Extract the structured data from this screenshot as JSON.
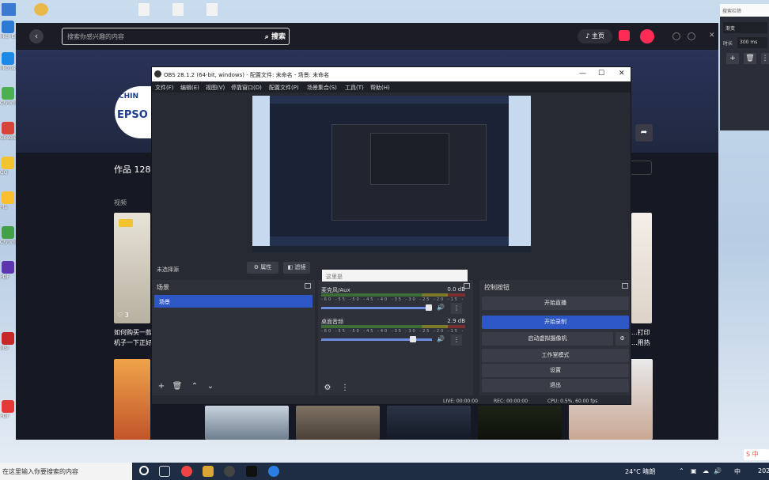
{
  "desktop": {
    "icons": [
      {
        "label": "Micr Edge"
      },
      {
        "label": "Micros Edge"
      },
      {
        "label": "Chrome"
      },
      {
        "label": "Google"
      },
      {
        "label": "QQ"
      },
      {
        "label": "Pla"
      },
      {
        "label": "Chrome"
      },
      {
        "label": "PDF"
      },
      {
        "label": "MSI"
      },
      {
        "label": "PDF"
      }
    ]
  },
  "browser": {
    "search_placeholder": "搜索你感兴趣的内容",
    "search_button": "搜索",
    "header_pill": "主页",
    "profile": {
      "logo_line1": "CHIN",
      "logo_line2": "EPSO",
      "works_label": "作品 128",
      "video_label": "视频"
    },
    "cards": [
      {
        "caption_l1": "如何购买一款",
        "caption_l2": "机子一下正好",
        "likes": "3"
      },
      {
        "caption_l1": "...打印",
        "caption_l2": "...用热"
      }
    ],
    "help": "?"
  },
  "side_panel": {
    "title": "搜索栏筛",
    "row1": "渐变",
    "row2_label": "时长",
    "row2_value": "300 ms",
    "add": "+",
    "delete": "🗑",
    "more": "⋮"
  },
  "obs": {
    "title": "OBS 28.1.2 (64-bit, windows) - 配置文件: 未命名 - 场景: 未命名",
    "menu": [
      "文件(F)",
      "编辑(E)",
      "视图(V)",
      "停靠窗口(D)",
      "配置文件(P)",
      "场景集合(S)",
      "工具(T)",
      "帮助(H)"
    ],
    "sources_bar": {
      "label": "未选择源",
      "props_button": "属性",
      "filters_button": "滤镜"
    },
    "tooltip": "这里是",
    "scenes": {
      "title": "场景",
      "items": [
        "场景"
      ]
    },
    "mixer": {
      "channels": [
        {
          "name": "麦克风/Aux",
          "db": "0.0 dB",
          "level": 0.97
        },
        {
          "name": "桌面音频",
          "db": "2.9 dB",
          "level": 0.83
        }
      ],
      "scale": "-60 -55 -50 -45 -40 -35 -30 -25 -20 -15 -10 -5 0"
    },
    "controls": {
      "title": "控制按钮",
      "buttons": [
        "开始直播",
        "开始录制",
        "启动虚拟摄像机",
        "工作室模式",
        "设置",
        "退出"
      ],
      "active_index": 1
    },
    "status": {
      "live": "LIVE: 00:00:00",
      "rec": "REC: 00:00:00",
      "cpu": "CPU: 0.5%, 60.00 fps"
    }
  },
  "taskbar": {
    "search": "在这里输入你要搜索的内容",
    "weather": "24°C 晴朗",
    "ime": "S 中",
    "lang": "中",
    "date": "202"
  }
}
